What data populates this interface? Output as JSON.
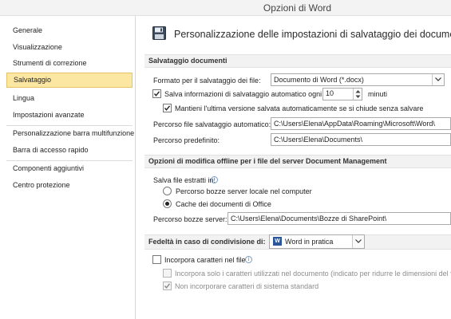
{
  "window": {
    "title": "Opzioni di Word"
  },
  "sidebar": {
    "items": [
      {
        "label": "Generale"
      },
      {
        "label": "Visualizzazione"
      },
      {
        "label": "Strumenti di correzione"
      },
      {
        "label": "Salvataggio",
        "selected": true
      },
      {
        "label": "Lingua"
      },
      {
        "label": "Impostazioni avanzate"
      },
      {
        "label": "Personalizzazione barra multifunzione"
      },
      {
        "label": "Barra di accesso rapido"
      },
      {
        "label": "Componenti aggiuntivi"
      },
      {
        "label": "Centro protezione"
      }
    ]
  },
  "header": {
    "icon": "save-disk-icon",
    "title": "Personalizzazione delle impostazioni di salvataggio dei documenti."
  },
  "save_docs": {
    "section_title": "Salvataggio documenti",
    "format_label": "Formato per il salvataggio dei file:",
    "format_value": "Documento di Word (*.docx)",
    "autosave_label": "Salva informazioni di salvataggio automatico ogni",
    "autosave_checked": true,
    "autosave_minutes": "10",
    "minutes_label": "minuti",
    "keep_last_label": "Mantieni l'ultima versione salvata automaticamente se si chiude senza salvare",
    "keep_last_checked": true,
    "autorecover_path_label": "Percorso file salvataggio automatico:",
    "autorecover_path_value": "C:\\Users\\Elena\\AppData\\Roaming\\Microsoft\\Word\\",
    "default_path_label": "Percorso predefinito:",
    "default_path_value": "C:\\Users\\Elena\\Documents\\"
  },
  "offline": {
    "section_title": "Opzioni di modifica offline per i file del server Document Management",
    "save_checked_out_label": "Salva file estratti in:",
    "option_local_label": "Percorso bozze server locale nel computer",
    "option_local_selected": false,
    "option_cache_label": "Cache dei documenti di Office",
    "option_cache_selected": true,
    "drafts_path_label": "Percorso bozze server:",
    "drafts_path_value": "C:\\Users\\Elena\\Documents\\Bozze di SharePoint\\"
  },
  "fidelity": {
    "section_title": "Fedeltà in caso di condivisione di:",
    "document_value": "Word in pratica",
    "embed_fonts_label": "Incorpora caratteri nel file",
    "embed_fonts_checked": false,
    "embed_used_only_label": "Incorpora solo i caratteri utilizzati nel documento (indicato per ridurre le dimensioni del file)",
    "embed_used_only_checked": false,
    "no_system_fonts_label": "Non incorporare caratteri di sistema standard",
    "no_system_fonts_checked": true
  },
  "colors": {
    "selected_bg": "#fce7a2",
    "selected_border": "#e5c365",
    "section_bg": "#f2f2f2",
    "word_blue": "#2b579a"
  }
}
